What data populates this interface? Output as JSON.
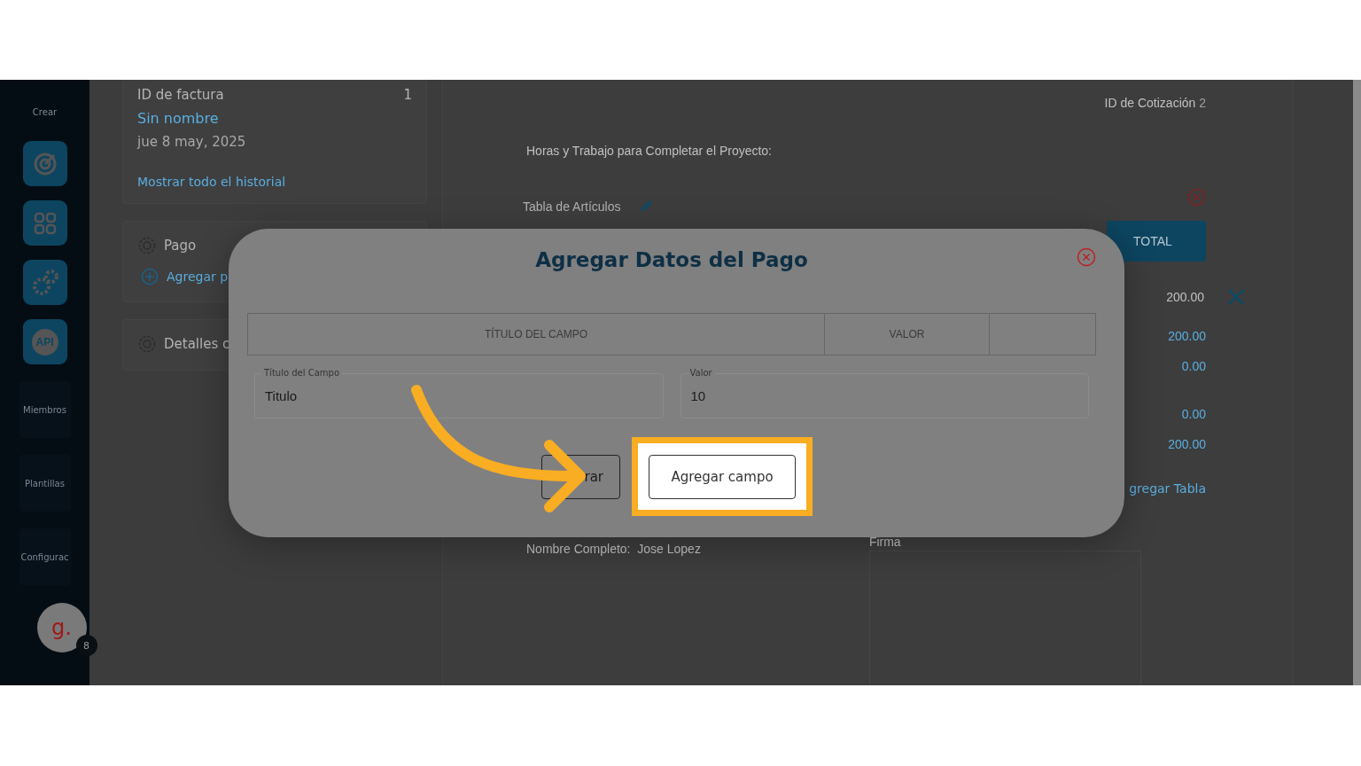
{
  "sidebar": {
    "create_label": "Crear",
    "icon_buttons": [
      {
        "kind": "target"
      },
      {
        "kind": "grid"
      },
      {
        "kind": "gears"
      },
      {
        "kind": "api",
        "label": "API"
      }
    ],
    "nav_items": [
      "Miembros",
      "Plantillas",
      "Configurac"
    ],
    "avatar": {
      "letter": "g.",
      "badge": "8"
    }
  },
  "history_card": {
    "id_label": "ID de factura",
    "id_value": "1",
    "name": "Sin nombre",
    "date": "jue 8 may, 2025",
    "link": "Mostrar todo el historial"
  },
  "sections": [
    {
      "title": "Pago",
      "action": "Agregar p"
    },
    {
      "title": "Detalles c"
    }
  ],
  "document": {
    "quote_id_label": "ID de Cotización",
    "quote_id_value": "2",
    "heading": "Horas y Trabajo para Completar el Proyecto:",
    "table_label": "Tabla de Artículos",
    "total_header": "TOTAL",
    "row_total": "200.00",
    "summary_values": [
      "200.00",
      "0.00",
      "0.00",
      "200.00"
    ],
    "add_table_link": "gregar Tabla",
    "full_name_label": "Nombre Completo:",
    "full_name_value": "Jose Lopez",
    "signature_label": "Firma"
  },
  "modal": {
    "title": "Agregar Datos del Pago",
    "columns": [
      "TÍTULO DEL CAMPO",
      "VALOR"
    ],
    "fields": [
      {
        "label": "Título del Campo",
        "value": "Titulo"
      },
      {
        "label": "Valor",
        "value": "10"
      }
    ],
    "buttons": [
      {
        "label": "rar",
        "highlighted": false
      },
      {
        "label": "Agregar campo",
        "highlighted": true
      }
    ]
  }
}
